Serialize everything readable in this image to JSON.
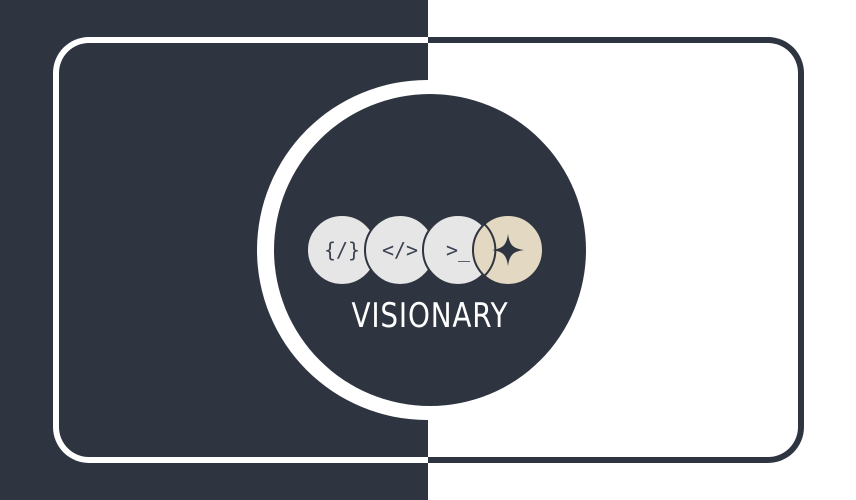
{
  "logo": {
    "wordmark": "VISIONARY",
    "icons": [
      {
        "name": "curly-braces-slash-icon",
        "glyph": "{/}"
      },
      {
        "name": "angle-brackets-slash-icon",
        "glyph": "</>"
      },
      {
        "name": "terminal-prompt-icon",
        "glyph": ">_"
      },
      {
        "name": "four-point-star-icon",
        "glyph": "✦"
      }
    ]
  },
  "colors": {
    "dark": "#2e3440",
    "light": "#ffffff",
    "chip": "#e6e6e6",
    "accent_chip": "#e3d8c1"
  }
}
